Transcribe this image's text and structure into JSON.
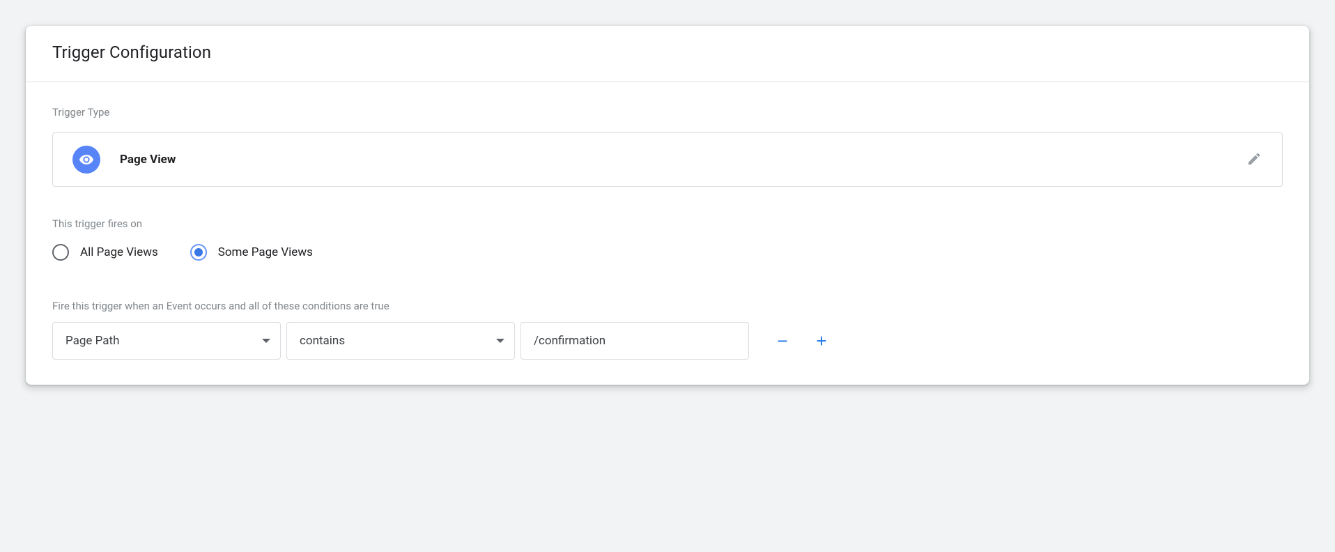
{
  "header": {
    "title": "Trigger Configuration"
  },
  "triggerType": {
    "label": "Trigger Type",
    "name": "Page View"
  },
  "firesOn": {
    "label": "This trigger fires on",
    "options": {
      "all": "All Page Views",
      "some": "Some Page Views"
    }
  },
  "conditions": {
    "label": "Fire this trigger when an Event occurs and all of these conditions are true",
    "rows": [
      {
        "variable": "Page Path",
        "operator": "contains",
        "value": "/confirmation"
      }
    ]
  }
}
